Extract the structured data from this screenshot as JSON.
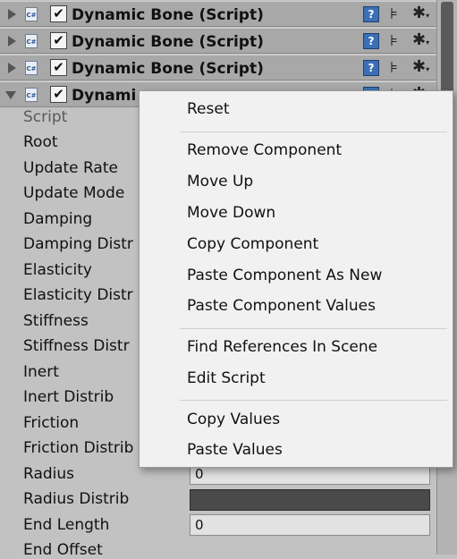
{
  "components": [
    {
      "title": "Dynamic Bone (Script)",
      "expanded": false,
      "enabled": true
    },
    {
      "title": "Dynamic Bone (Script)",
      "expanded": false,
      "enabled": true
    },
    {
      "title": "Dynamic Bone (Script)",
      "expanded": false,
      "enabled": true
    },
    {
      "title": "Dynami",
      "expanded": true,
      "enabled": true
    }
  ],
  "icons": {
    "script": "cs-script-icon",
    "checkbox": "✔",
    "help": "help-book-icon",
    "presets": "⊧",
    "gear": "✱"
  },
  "properties": [
    {
      "label": "Script"
    },
    {
      "label": "Root"
    },
    {
      "label": "Update Rate"
    },
    {
      "label": "Update Mode"
    },
    {
      "label": "Damping"
    },
    {
      "label": "Damping Distr"
    },
    {
      "label": "Elasticity"
    },
    {
      "label": "Elasticity Distr"
    },
    {
      "label": "Stiffness"
    },
    {
      "label": "Stiffness Distr"
    },
    {
      "label": "Inert"
    },
    {
      "label": "Inert Distrib"
    },
    {
      "label": "Friction"
    },
    {
      "label": "Friction Distrib"
    },
    {
      "label": "Radius",
      "value": "0"
    },
    {
      "label": "Radius Distrib"
    },
    {
      "label": "End Length",
      "value": "0"
    },
    {
      "label": "End Offset"
    }
  ],
  "context_menu": {
    "items": [
      "Reset",
      "Remove Component",
      "Move Up",
      "Move Down",
      "Copy Component",
      "Paste Component As New",
      "Paste Component Values",
      "Find References In Scene",
      "Edit Script",
      "Copy Values",
      "Paste Values"
    ]
  }
}
